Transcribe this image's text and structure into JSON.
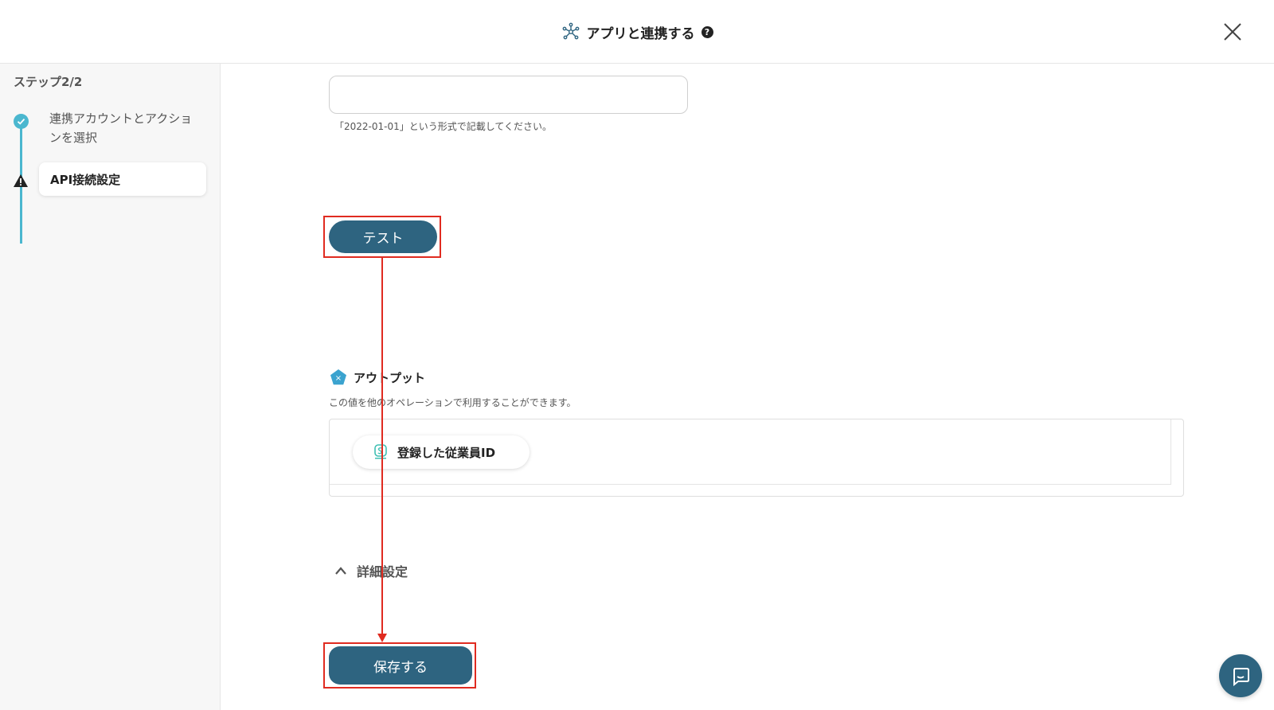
{
  "header": {
    "title": "アプリと連携する",
    "help_glyph": "?"
  },
  "sidebar": {
    "step_counter": "ステップ2/2",
    "steps": [
      {
        "label": "連携アカウントとアクションを選択",
        "status": "done"
      },
      {
        "label": "API接続設定",
        "status": "warning"
      }
    ]
  },
  "form": {
    "date_hint": "「2022-01-01」という形式で記載してください。"
  },
  "test_button": {
    "label": "テスト"
  },
  "output": {
    "title": "アウトプット",
    "icon_glyph": "×",
    "description": "この値を他のオペレーションで利用することができます。",
    "items": [
      {
        "label": "登録した従業員ID"
      }
    ]
  },
  "advanced": {
    "label": "詳細設定"
  },
  "save_button": {
    "label": "保存する"
  },
  "colors": {
    "accent": "#2e6480",
    "step_done": "#4bb7cf",
    "highlight": "#e02b20"
  }
}
